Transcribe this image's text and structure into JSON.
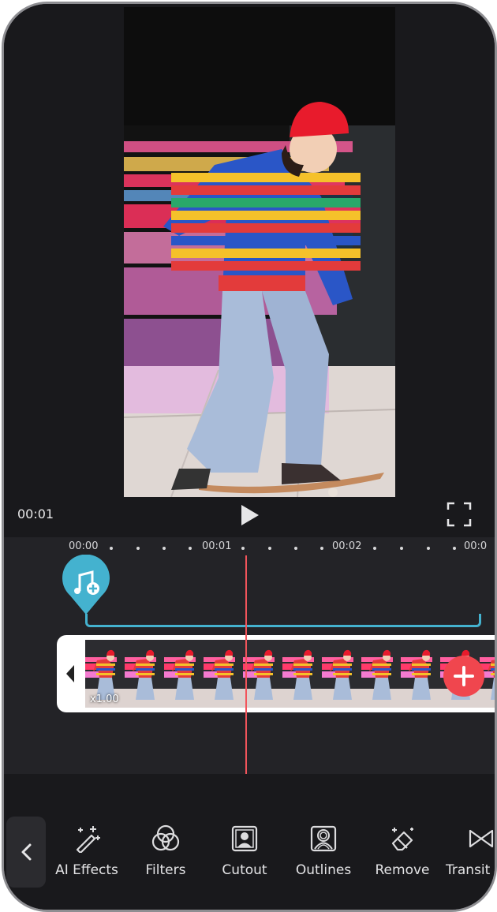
{
  "preview": {
    "current_time": "00:01"
  },
  "timeline": {
    "ruler": [
      "00:00",
      "00:01",
      "00:02",
      "00:0"
    ],
    "clip_speed": "x1.00"
  },
  "tools": [
    {
      "label": "AI Effects",
      "icon": "magic-wand-icon"
    },
    {
      "label": "Filters",
      "icon": "filters-icon"
    },
    {
      "label": "Cutout",
      "icon": "cutout-icon"
    },
    {
      "label": "Outlines",
      "icon": "outlines-icon"
    },
    {
      "label": "Remove",
      "icon": "eraser-icon"
    },
    {
      "label": "Transit",
      "icon": "transition-icon"
    }
  ],
  "colors": {
    "accent_red": "#f0464e",
    "audio_teal": "#44b2cf",
    "background": "#19191c"
  }
}
